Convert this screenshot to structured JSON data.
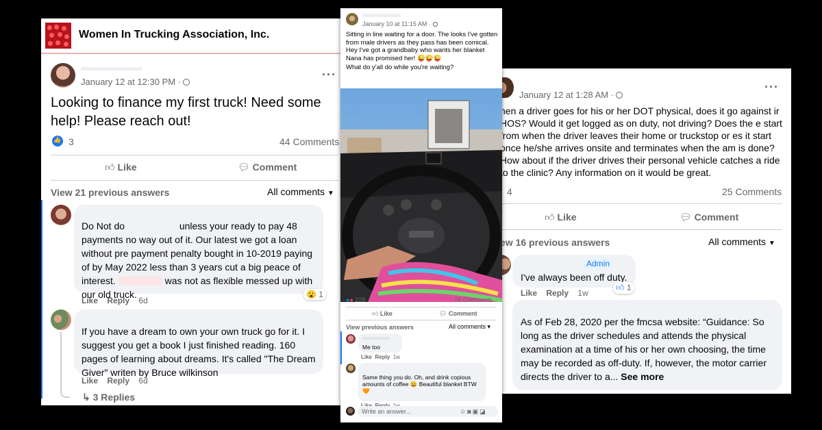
{
  "left_post": {
    "group_name": "Women In Trucking Association, Inc.",
    "timestamp": "January 12 at 12:30 PM ·",
    "text": "Looking to finance my first truck! Need some help! Please reach out!",
    "reaction_count": "3",
    "comment_count": "44 Comments",
    "actions": {
      "like": "Like",
      "comment": "Comment"
    },
    "view_previous": "View 21 previous answers",
    "sort": "All comments",
    "comments": [
      {
        "text_a": "Do Not do",
        "text_b": "unless your ready to pay 48 payments no way out of it. Our latest we got a loan without pre payment penalty bought in 10-2019 paying of by May 2022 less than 3 years cut a big peace of interest.",
        "text_c": "was not as flexible messed up with our old truck.",
        "like": "Like",
        "reply": "Reply",
        "age": "6d",
        "reaction_count": "1"
      },
      {
        "text": "If you have a dream to own your own truck go for it. I suggest you get a book I just finished reading. 160 pages of learning about dreams. It's called \"The Dream Giver\" writen by Bruce wilkinson",
        "like": "Like",
        "reply": "Reply",
        "age": "6d"
      }
    ],
    "replies_link": "↳ 3 Replies"
  },
  "middle_post": {
    "timestamp": "January 10 at 11:15 AM ·",
    "text_1": "Sitting in line waiting for a door. The looks I've gotten from male drivers as they pass has been comical.",
    "text_2": " Hey I've got a grandbaby who wants her blanket Nana has promised her! 😜😜😜",
    "text_3": "What do y'all do while you're waiting?",
    "reaction_count": "228",
    "comment_count": "78 Comments",
    "actions": {
      "like": "Like",
      "comment": "Comment"
    },
    "view_previous": "View previous answers",
    "sort": "All comments ▾",
    "comments": [
      {
        "text": "Me too",
        "like": "Like",
        "reply": "Reply",
        "age": "1w"
      },
      {
        "text": "Same thing you do. Oh, and drink copious amounts of coffee 😄 Beautiful blanket BTW 🧡",
        "like": "Like",
        "reply": "Reply",
        "age": "1w"
      }
    ],
    "write_placeholder": "Write an answer..."
  },
  "right_post": {
    "timestamp": "January 12 at 1:28 AM ·",
    "text": "hen a driver goes for his or her DOT physical, does it go against ir HOS? Would it get logged as on duty, not driving? Does the e start from when the driver leaves their home or truckstop or es it start once he/she arrives onsite and terminates when the am is done? How about if the driver drives their personal vehicle catches a ride to the clinic? Any information on it would be great.",
    "reaction_count": "4",
    "comment_count": "25 Comments",
    "actions": {
      "like": "Like",
      "comment": "Comment"
    },
    "view_previous": "ew 16 previous answers",
    "sort": "All comments",
    "comments": [
      {
        "badge": "Admin",
        "text": "I've always been off duty.",
        "like": "Like",
        "reply": "Reply",
        "age": "1w",
        "reaction_count": "1"
      },
      {
        "text": "As of Feb 28, 2020 per the fmcsa website: “Guidance: So long as the driver schedules and attends the physical examination at a time of his or her own choosing, the time may be recorded as off-duty. If, however, the motor carrier directs the driver to a...",
        "see_more": "See more"
      }
    ]
  },
  "colors": {
    "facebook_blue": "#1877f2",
    "bubble_gray": "#f0f2f5",
    "meta_gray": "#65676b",
    "brand_red": "#b7131e"
  }
}
